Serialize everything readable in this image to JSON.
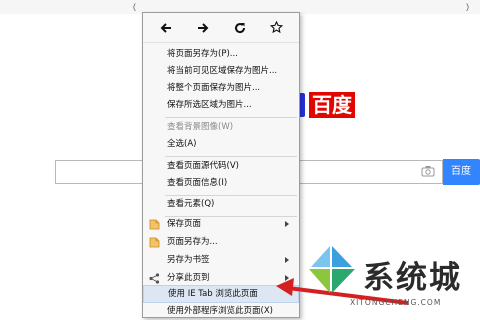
{
  "background": {
    "top_links": [
      "（",
      "）"
    ],
    "logo_text": "百度",
    "search_button": "百度一"
  },
  "menu": {
    "nav_icons": [
      "back-arrow-icon",
      "forward-arrow-icon",
      "refresh-icon",
      "star-icon"
    ],
    "items": [
      {
        "label": "将页面另存为(P)...",
        "disabled": false
      },
      {
        "label": "将当前可见区域保存为图片...",
        "disabled": false
      },
      {
        "label": "将整个页面保存为图片...",
        "disabled": false
      },
      {
        "label": "保存所选区域为图片...",
        "disabled": false
      },
      {
        "label": "查看背景图像(W)",
        "disabled": true
      },
      {
        "label": "全选(A)",
        "disabled": false
      },
      {
        "label": "查看页面源代码(V)",
        "disabled": false
      },
      {
        "label": "查看页面信息(I)",
        "disabled": false
      },
      {
        "label": "查看元素(Q)",
        "disabled": false
      },
      {
        "label": "保存页面",
        "disabled": false,
        "submenu": true,
        "icon": "page-icon"
      },
      {
        "label": "页面另存为...",
        "disabled": false,
        "icon": "page-icon"
      },
      {
        "label": "另存为书签",
        "disabled": false,
        "submenu": true
      },
      {
        "label": "分享此页到",
        "disabled": false,
        "submenu": true,
        "icon": "share-icon"
      },
      {
        "label": "使用 IE Tab 浏览此页面",
        "disabled": false,
        "highlighted": true
      },
      {
        "label": "使用外部程序浏览此页面(X)",
        "disabled": false
      }
    ]
  },
  "watermark": {
    "title": "系统城",
    "url": "XITONGCHENG.COM"
  },
  "colors": {
    "accent": "#3385ff",
    "baidu_red": "#e10602",
    "baidu_blue": "#2932e1",
    "arrow_red": "#d42020"
  }
}
